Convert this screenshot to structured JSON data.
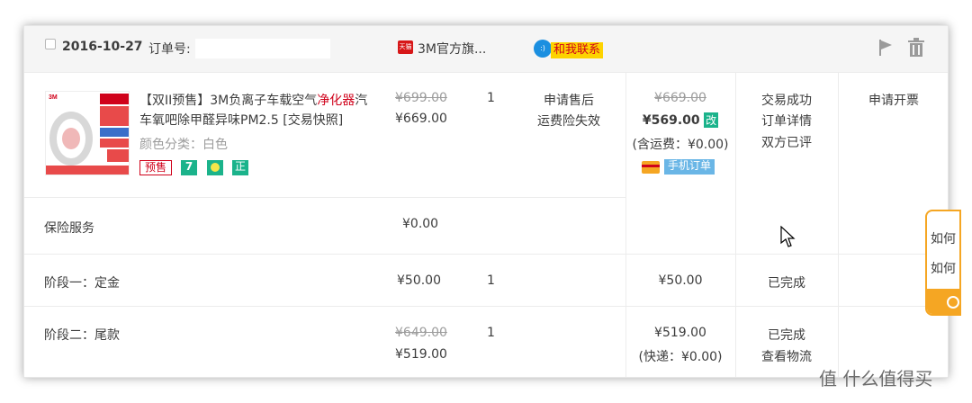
{
  "order": {
    "date": "2016-10-27",
    "order_no_label": "订单号:",
    "shop_name": "3M官方旗...",
    "tmall_badge": "天猫",
    "contact_label": "和我联系"
  },
  "product": {
    "title_line1_a": "【双II预售】3M负离子车载空气",
    "title_line1_b": "净化器",
    "title_line1_c": "汽",
    "title_line2": "车氧吧除甲醛异味PM2.5 [交易快照]",
    "sku": "颜色分类：白色",
    "tags": [
      "预售",
      "7",
      "正"
    ],
    "original_price": "¥699.00",
    "price": "¥669.00",
    "quantity": "1",
    "aftersale": [
      "申请售后",
      "运费险失效"
    ]
  },
  "payment": {
    "original_total": "¥669.00",
    "total": "¥569.00",
    "modified_badge": "改",
    "shipping_note": "(含运费：¥0.00)",
    "mobile_order": "手机订单"
  },
  "status": [
    "交易成功",
    "订单详情",
    "双方已评"
  ],
  "action": "申请开票",
  "insurance": {
    "label": "保险服务",
    "price": "¥0.00"
  },
  "stage1": {
    "label": "阶段一：定金",
    "price": "¥50.00",
    "quantity": "1",
    "total": "¥50.00",
    "status": "已完成"
  },
  "stage2": {
    "label": "阶段二：尾款",
    "original_price": "¥649.00",
    "price": "¥519.00",
    "quantity": "1",
    "total": "¥519.00",
    "shipping_note": "(快递：¥0.00)",
    "status": [
      "已完成",
      "查看物流"
    ]
  },
  "side_panel": {
    "items": [
      "如何",
      "如何"
    ]
  },
  "watermark": "值 什么值得买",
  "colors": {
    "accent_red": "#d0021b",
    "tag_teal": "#1bb38b",
    "badge_blue": "#6ab6e6",
    "side_orange": "#f5a623"
  }
}
